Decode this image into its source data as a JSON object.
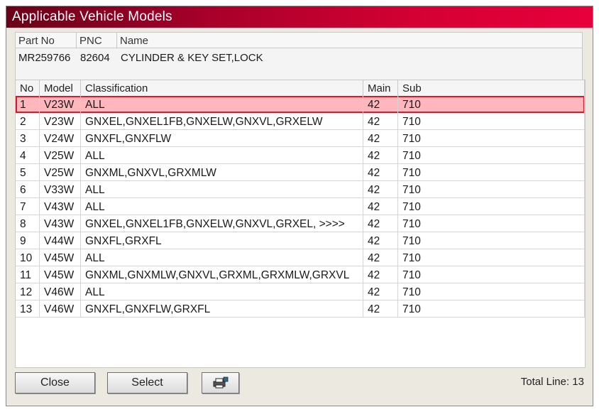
{
  "window": {
    "title": "Applicable Vehicle Models"
  },
  "part": {
    "headers": {
      "part_no": "Part No",
      "pnc": "PNC",
      "name": "Name"
    },
    "values": {
      "part_no": "MR259766",
      "pnc": "82604",
      "name": "CYLINDER & KEY SET,LOCK"
    }
  },
  "table": {
    "headers": {
      "no": "No",
      "model": "Model",
      "classification": "Classification",
      "main": "Main",
      "sub": "Sub"
    },
    "selected_row": 1,
    "rows": [
      {
        "no": "1",
        "model": "V23W",
        "classification": "ALL",
        "main": "42",
        "sub": "710"
      },
      {
        "no": "2",
        "model": "V23W",
        "classification": "GNXEL,GNXEL1FB,GNXELW,GNXVL,GRXELW",
        "main": "42",
        "sub": "710"
      },
      {
        "no": "3",
        "model": "V24W",
        "classification": "GNXFL,GNXFLW",
        "main": "42",
        "sub": "710"
      },
      {
        "no": "4",
        "model": "V25W",
        "classification": "ALL",
        "main": "42",
        "sub": "710"
      },
      {
        "no": "5",
        "model": "V25W",
        "classification": "GNXML,GNXVL,GRXMLW",
        "main": "42",
        "sub": "710"
      },
      {
        "no": "6",
        "model": "V33W",
        "classification": "ALL",
        "main": "42",
        "sub": "710"
      },
      {
        "no": "7",
        "model": "V43W",
        "classification": "ALL",
        "main": "42",
        "sub": "710"
      },
      {
        "no": "8",
        "model": "V43W",
        "classification": "GNXEL,GNXEL1FB,GNXELW,GNXVL,GRXEL,  >>>>",
        "main": "42",
        "sub": "710"
      },
      {
        "no": "9",
        "model": "V44W",
        "classification": "GNXFL,GRXFL",
        "main": "42",
        "sub": "710"
      },
      {
        "no": "10",
        "model": "V45W",
        "classification": "ALL",
        "main": "42",
        "sub": "710"
      },
      {
        "no": "11",
        "model": "V45W",
        "classification": "GNXML,GNXMLW,GNXVL,GRXML,GRXMLW,GRXVL",
        "main": "42",
        "sub": "710"
      },
      {
        "no": "12",
        "model": "V46W",
        "classification": "ALL",
        "main": "42",
        "sub": "710"
      },
      {
        "no": "13",
        "model": "V46W",
        "classification": "GNXFL,GNXFLW,GRXFL",
        "main": "42",
        "sub": "710"
      }
    ]
  },
  "footer": {
    "close_label": "Close",
    "select_label": "Select",
    "print_icon": "printer-icon",
    "total_text": "Total Line: 13"
  },
  "colors": {
    "title_gradient_start": "#6b0018",
    "title_gradient_end": "#e8003c",
    "selected_row_bg": "#ffb6bc",
    "selected_row_border": "#d01c2c"
  }
}
